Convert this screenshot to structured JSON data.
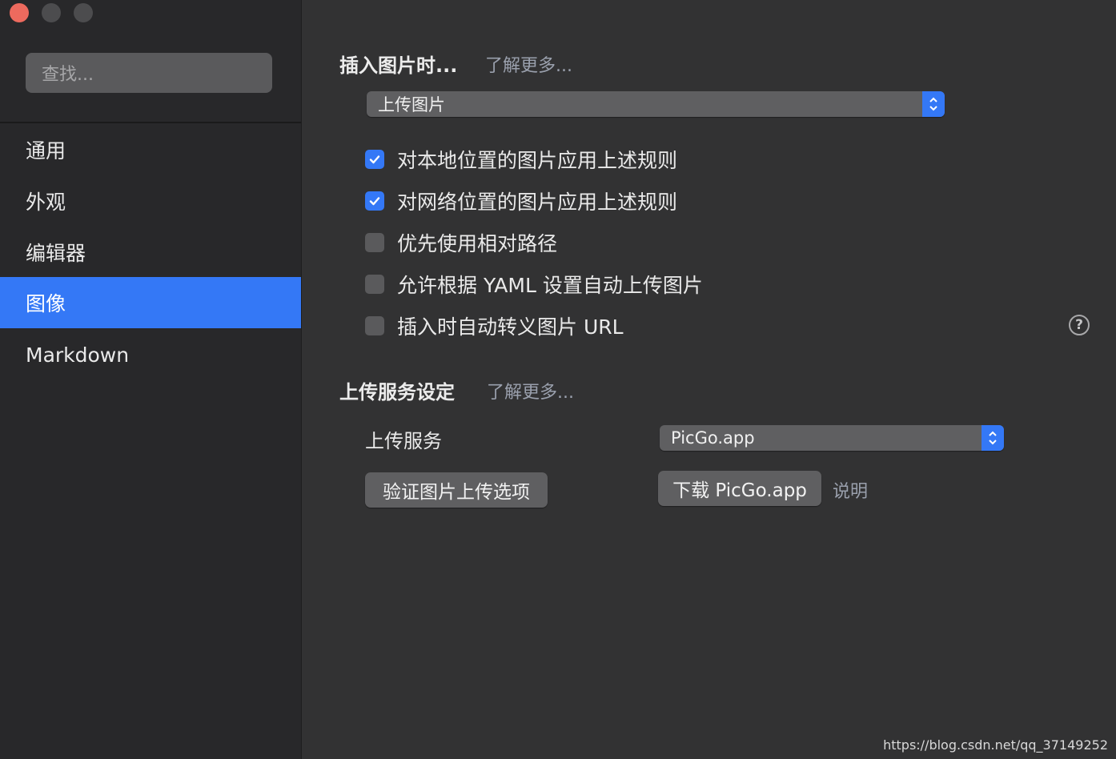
{
  "window": {
    "controls": [
      "close",
      "minimize",
      "zoom"
    ]
  },
  "sidebar": {
    "search_placeholder": "查找...",
    "items": [
      {
        "label": "通用",
        "active": false
      },
      {
        "label": "外观",
        "active": false
      },
      {
        "label": "编辑器",
        "active": false
      },
      {
        "label": "图像",
        "active": true
      },
      {
        "label": "Markdown",
        "active": false
      }
    ]
  },
  "insert_image": {
    "title": "插入图片时...",
    "learn_more": "了解更多...",
    "select_value": "上传图片",
    "options": [
      {
        "label": "对本地位置的图片应用上述规则",
        "checked": true
      },
      {
        "label": "对网络位置的图片应用上述规则",
        "checked": true
      },
      {
        "label": "优先使用相对路径",
        "checked": false
      },
      {
        "label": "允许根据 YAML 设置自动上传图片",
        "checked": false
      },
      {
        "label": "插入时自动转义图片 URL",
        "checked": false
      }
    ],
    "help_icon": "?"
  },
  "upload_service": {
    "title": "上传服务设定",
    "learn_more": "了解更多...",
    "service_label": "上传服务",
    "service_value": "PicGo.app",
    "verify_button": "验证图片上传选项",
    "download_button": "下载 PicGo.app",
    "explain_link": "说明"
  },
  "watermark": "https://blog.csdn.net/qq_37149252",
  "colors": {
    "accent": "#3478f6",
    "close": "#ed6a5e",
    "background": "#323233",
    "sidebar": "#28282a"
  }
}
